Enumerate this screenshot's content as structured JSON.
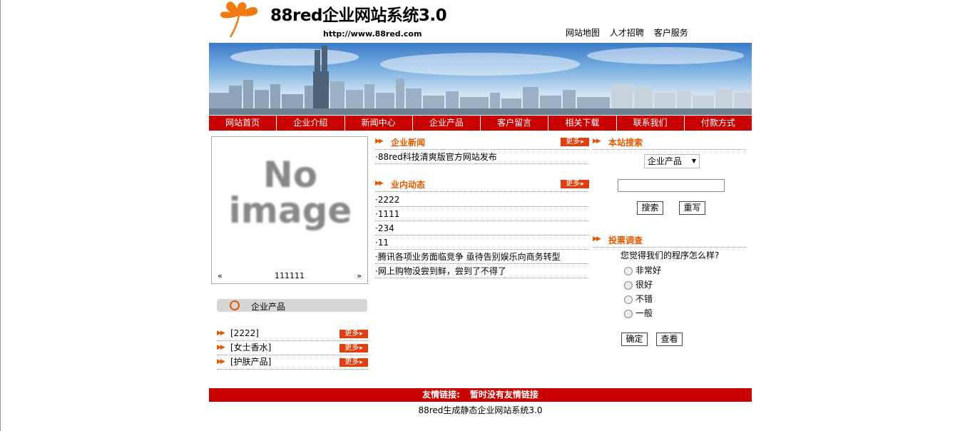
{
  "header": {
    "title": "88red企业网站系统3.0",
    "url": "http://www.88red.com",
    "top_links": [
      "网站地图",
      "人才招聘",
      "客户服务"
    ]
  },
  "nav": [
    "网站首页",
    "企业介绍",
    "新闻中心",
    "企业产品",
    "客户留言",
    "相关下载",
    "联系我们",
    "付款方式"
  ],
  "image_box": {
    "placeholder_line1": "No",
    "placeholder_line2": "image",
    "prev": "«",
    "next": "»",
    "caption": "111111"
  },
  "products": {
    "heading": "企业产品",
    "items": [
      "[2222]",
      "[女士香水]",
      "[护肤产品]"
    ],
    "more_label": "更多"
  },
  "company_news": {
    "title": "企业新闻",
    "more_label": "更多",
    "items": [
      "·88red科技清爽版官方网站发布"
    ]
  },
  "industry_news": {
    "title": "业内动态",
    "more_label": "更多",
    "items": [
      "·2222",
      "·1111",
      "·234",
      "·11",
      "·腾讯各项业务面临竞争  亟待告别娱乐向商务转型",
      "·网上购物没尝到鲜，尝到了不得了"
    ]
  },
  "search": {
    "title": "本站搜索",
    "select_value": "企业产品",
    "input_value": "",
    "search_btn": "搜索",
    "reset_btn": "重写"
  },
  "vote": {
    "title": "投票调查",
    "question": "您觉得我们的程序怎么样?",
    "options": [
      "非常好",
      "很好",
      "不错",
      "一般"
    ],
    "submit_btn": "确定",
    "view_btn": "查看"
  },
  "footer": {
    "links_label": "友情链接:",
    "links_value": "暂时没有友情链接",
    "copyright": "88red生成静态企业网站系统3.0"
  },
  "colors": {
    "nav_red": "#c80000",
    "accent_orange": "#e05a00"
  }
}
